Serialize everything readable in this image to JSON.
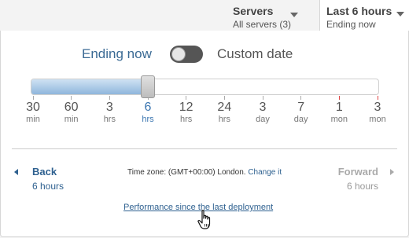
{
  "header": {
    "servers": {
      "title": "Servers",
      "subtitle": "All servers (3)"
    },
    "time": {
      "title": "Last 6 hours",
      "subtitle": "Ending now"
    }
  },
  "mode": {
    "ending_label": "Ending now",
    "custom_label": "Custom date",
    "custom_enabled": false
  },
  "slider": {
    "selected_index": 3,
    "ticks": [
      {
        "num": "30",
        "unit": "min"
      },
      {
        "num": "60",
        "unit": "min"
      },
      {
        "num": "3",
        "unit": "hrs"
      },
      {
        "num": "6",
        "unit": "hrs"
      },
      {
        "num": "12",
        "unit": "hrs"
      },
      {
        "num": "24",
        "unit": "hrs"
      },
      {
        "num": "3",
        "unit": "day"
      },
      {
        "num": "7",
        "unit": "day"
      },
      {
        "num": "1",
        "unit": "mon"
      },
      {
        "num": "3",
        "unit": "mon"
      }
    ]
  },
  "nav": {
    "back": {
      "title": "Back",
      "subtitle": "6 hours"
    },
    "forward": {
      "title": "Forward",
      "subtitle": "6 hours"
    }
  },
  "timezone": {
    "text": "Time zone: (GMT+00:00) London.",
    "link": "Change it"
  },
  "performance_link": "Performance since the last deployment",
  "colors": {
    "accent": "#3a75b0",
    "link": "#2f6190",
    "slider_fill": "#8fb6dc"
  }
}
